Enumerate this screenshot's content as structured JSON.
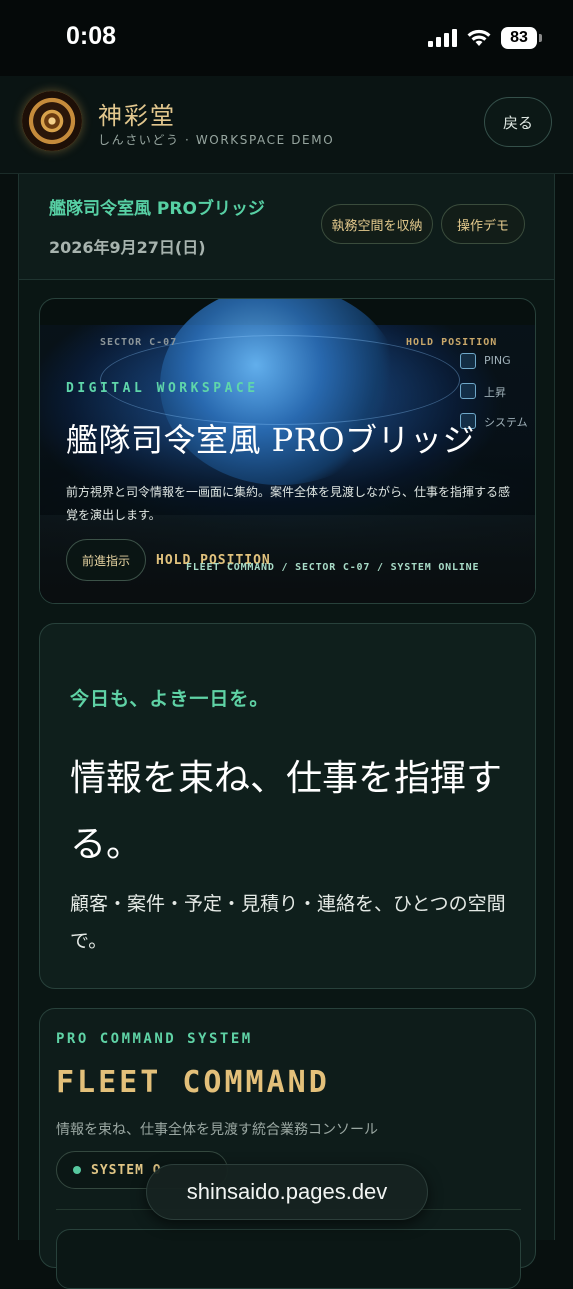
{
  "status_bar": {
    "time": "0:08",
    "battery": "83",
    "icons": [
      "cellular-signal-icon",
      "wifi-icon",
      "battery-icon"
    ]
  },
  "header": {
    "brand_name": "神彩堂",
    "brand_sub": "しんさいどう · WORKSPACE DEMO",
    "back_label": "戻る"
  },
  "subheader": {
    "title": "艦隊司令室風 PROブリッジ",
    "date": "2026年9月27日(日)",
    "collapse_label": "執務空間を収納",
    "demo_label": "操作デモ"
  },
  "hero": {
    "hud_sector": "SECTOR C-07",
    "hud_hold": "HOLD POSITION",
    "hud_side": [
      "PING",
      "上昇",
      "システム"
    ],
    "kicker": "DIGITAL WORKSPACE",
    "title": "艦隊司令室風 PROブリッジ",
    "description": "前方視界と司令情報を一画面に集約。案件全体を見渡しながら、仕事を指揮する感覚を演出します。",
    "button_label": "前進指示",
    "hold_label": "HOLD POSITION",
    "fleet_line": "FLEET COMMAND / SECTOR C-07 / SYSTEM ONLINE"
  },
  "greeting": {
    "kicker": "今日も、よき一日を。",
    "title": "情報を束ね、仕事を指揮する。",
    "subtitle": "顧客・案件・予定・見積り・連絡を、ひとつの空間で。"
  },
  "command": {
    "kicker": "PRO COMMAND SYSTEM",
    "title": "FLEET COMMAND",
    "subtitle": "情報を束ね、仕事全体を見渡す統合業務コンソール",
    "status_label": "SYSTEM O"
  },
  "url_toast": "shinsaido.pages.dev",
  "colors": {
    "accent_green": "#57d0a4",
    "accent_gold": "#e3c07a",
    "background": "#08100f"
  }
}
